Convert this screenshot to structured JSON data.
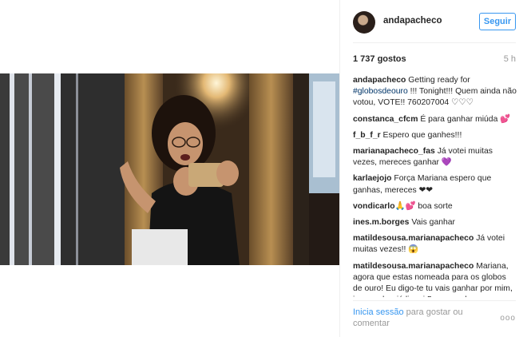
{
  "post": {
    "username": "andapacheco",
    "follow_label": "Seguir",
    "likes": "1 737 gostos",
    "time": "5 h",
    "caption": {
      "user": "andapacheco",
      "text_1": " Getting ready for ",
      "hashtag": "#globosdeouro",
      "text_2": " !!! Tonight!!! Quem ainda não votou, VOTE!! 760207004 ♡♡♡"
    }
  },
  "comments": [
    {
      "user": "constanca_cfcm",
      "text": " É para ganhar miúda ",
      "emoji": "💕"
    },
    {
      "user": "f_b_f_r",
      "text": " Espero que ganhes!!!"
    },
    {
      "user": "marianapacheco_fas",
      "text": " Já votei muitas vezes, mereces ganhar ",
      "emoji": "💜"
    },
    {
      "user": "karlaejojo",
      "text": " Força Mariana espero que ganhas, mereces ",
      "emoji": "❤❤"
    },
    {
      "user": "vondicarlo",
      "text": " boa sorte",
      "emoji": "🙏💕"
    },
    {
      "user": "ines.m.borges",
      "text": " Vais ganhar"
    },
    {
      "user": "matildesousa.marianapacheco",
      "text": " Já votei muitas vezes!! ",
      "emoji": "😱"
    },
    {
      "user": "matildesousa.marianapacheco",
      "text": " Mariana, agora que estas nomeada para os globos de ouro! Eu digo-te tu vais ganhar por mim, iras ganhar já liguei 5 vezes, algumas amigas também já ligaram muitas vezes. Sem duvida, tu és a melhor atriz do"
    }
  ],
  "footer": {
    "login_label": "Inicia sessão",
    "rest": " para gostar ou comentar",
    "more": "ooo"
  }
}
